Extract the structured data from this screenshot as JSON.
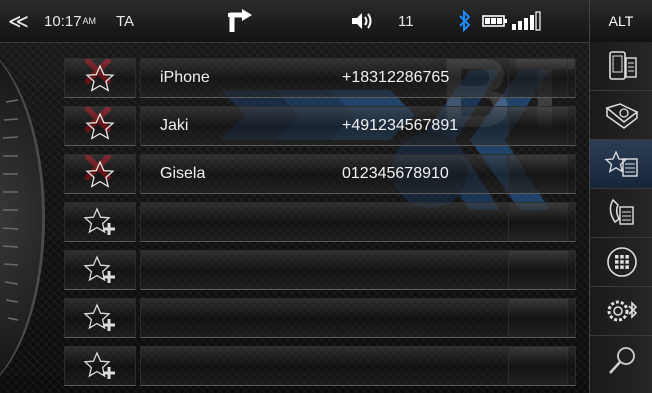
{
  "statusbar": {
    "back_glyph": "≪",
    "time": "10:17",
    "ampm": "AM",
    "source": "TA",
    "volume": "11",
    "alt_label": "ALT",
    "icons": [
      "nav-turn-icon",
      "speaker-icon",
      "bluetooth-icon",
      "battery-icon",
      "signal-icon"
    ]
  },
  "watermark": "BT",
  "favorites": [
    {
      "name": "iPhone",
      "number": "+18312286765",
      "filled": true
    },
    {
      "name": "Jaki",
      "number": "+491234567891",
      "filled": true
    },
    {
      "name": "Gisela",
      "number": "012345678910",
      "filled": true
    },
    {
      "name": "",
      "number": "",
      "filled": false
    },
    {
      "name": "",
      "number": "",
      "filled": false
    },
    {
      "name": "",
      "number": "",
      "filled": false
    },
    {
      "name": "",
      "number": "",
      "filled": false
    }
  ],
  "sidebar": [
    "phone-contacts-icon",
    "address-book-icon",
    "favorites-icon",
    "call-log-icon",
    "keypad-icon",
    "bt-settings-icon",
    "search-icon"
  ],
  "colors": {
    "delete": "#c0111c",
    "accent": "#1e6fd0",
    "active_bg": "#1b2f47"
  }
}
